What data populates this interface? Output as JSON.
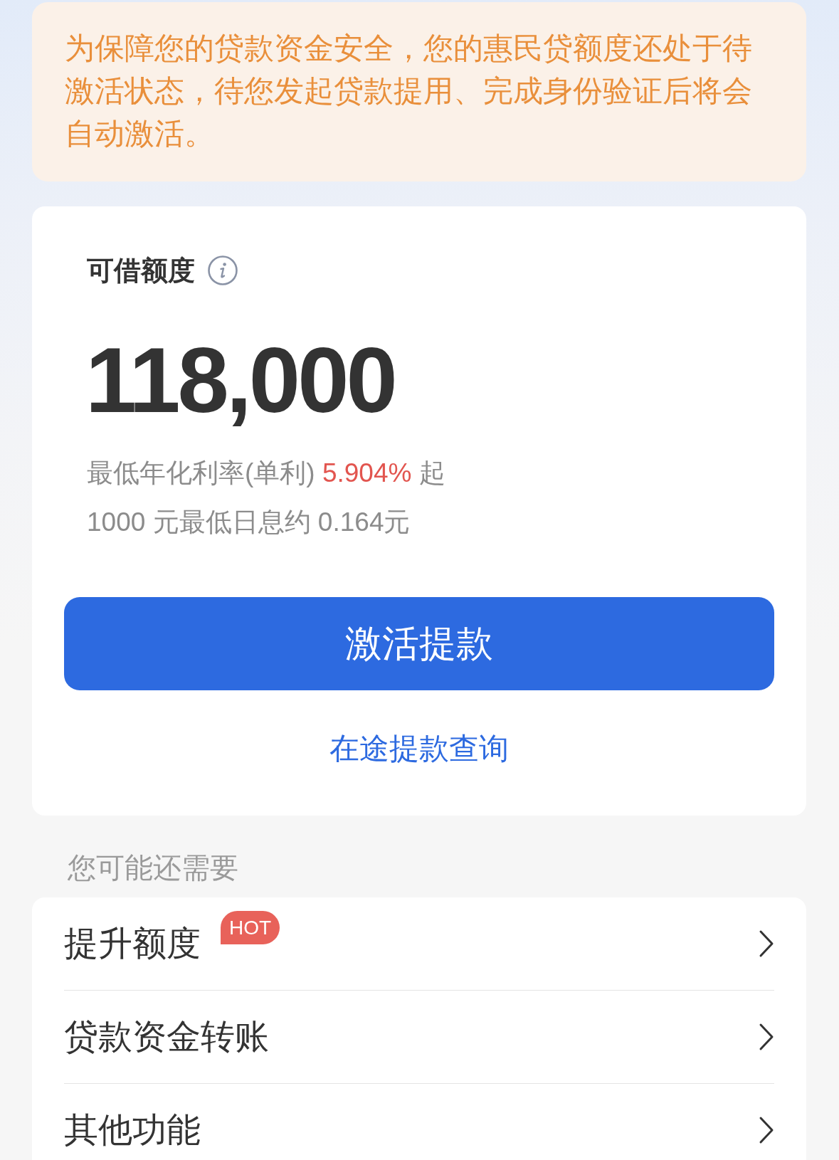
{
  "notice": {
    "text": "为保障您的贷款资金安全，您的惠民贷额度还处于待激活状态，待您发起贷款提用、完成身份验证后将会自动激活。"
  },
  "credit": {
    "label": "可借额度",
    "amount": "118,000",
    "rate_line": {
      "prefix": "最低年化利率(单利)",
      "rate": "5.904%",
      "suffix": "起"
    },
    "interest_line": "1000 元最低日息约 0.164元",
    "primary_button": "激活提款",
    "link": "在途提款查询"
  },
  "more": {
    "title": "您可能还需要",
    "items": [
      {
        "label": "提升额度",
        "badge": "HOT"
      },
      {
        "label": "贷款资金转账"
      },
      {
        "label": "其他功能"
      }
    ]
  }
}
